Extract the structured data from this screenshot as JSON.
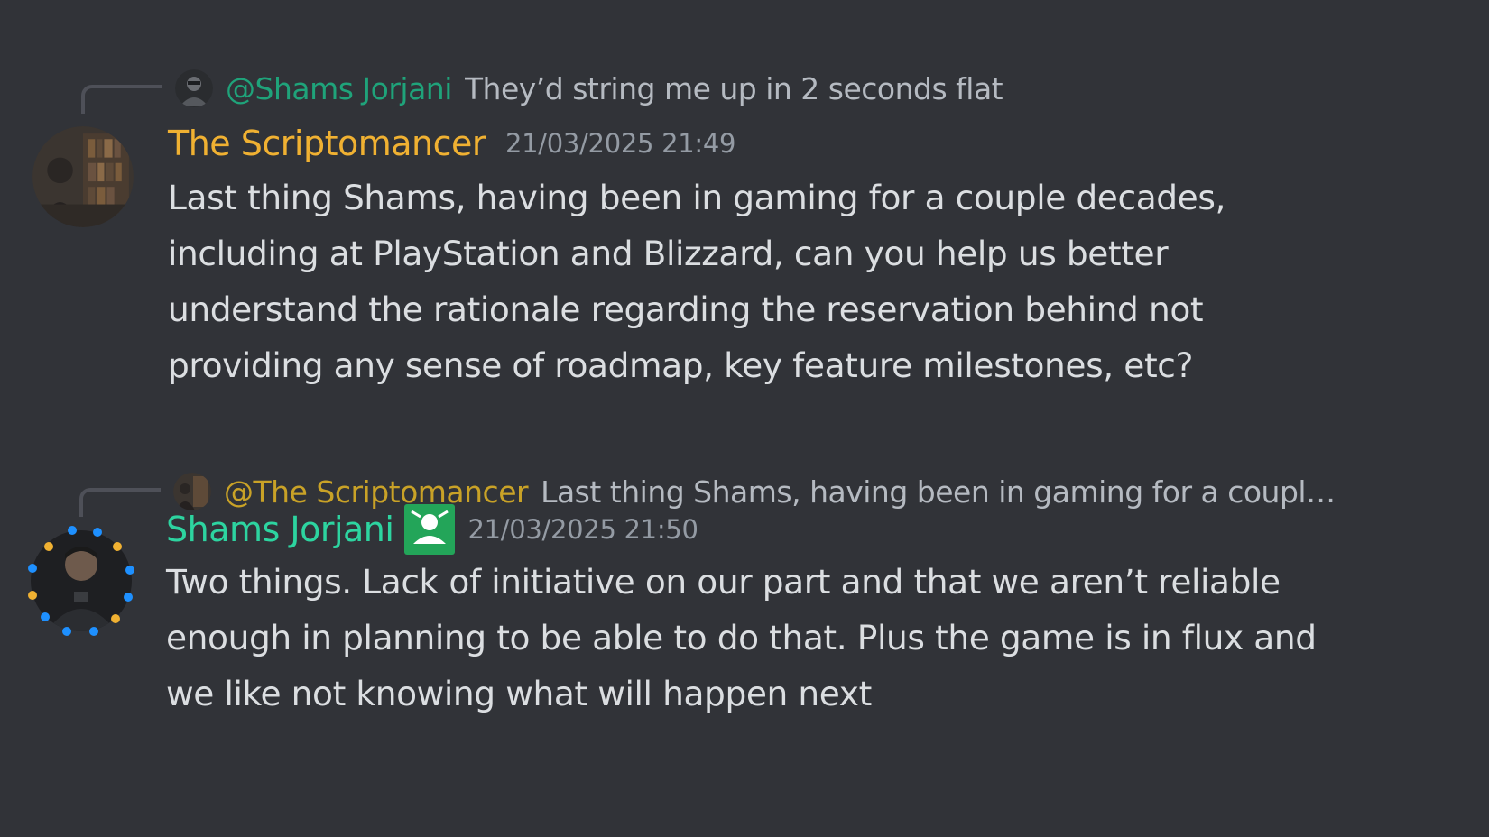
{
  "colors": {
    "background": "#313338",
    "text": "#dbdee1",
    "muted": "#b5bac1",
    "timestamp": "#949ba4",
    "scriptomancer": "#f0b132",
    "scriptomancer_reply": "#c9a227",
    "shams": "#2dd4a0",
    "shams_reply": "#1fa37a",
    "badge": "#23a559"
  },
  "messages": [
    {
      "reply": {
        "author": "@Shams Jorjani",
        "text": "They’d string me up in 2 seconds flat",
        "avatar_icon": "shams-jorjani-small-avatar"
      },
      "author": "The Scriptomancer",
      "timestamp": "21/03/2025 21:49",
      "avatar_icon": "scriptomancer-avatar",
      "lines": [
        "Last thing Shams, having been in gaming for a couple decades,",
        "including at PlayStation and Blizzard, can you help us better",
        "understand the rationale regarding the reservation behind not",
        "providing any sense of roadmap, key feature milestones, etc?"
      ]
    },
    {
      "reply": {
        "author": "@The Scriptomancer",
        "text": "Last thing Shams, having been in gaming for a coupl…",
        "avatar_icon": "scriptomancer-small-avatar"
      },
      "author": "Shams Jorjani",
      "badge_icon": "staff-badge-icon",
      "timestamp": "21/03/2025 21:50",
      "avatar_icon": "shams-jorjani-avatar",
      "lines": [
        "Two things. Lack of initiative on our part and that we aren’t reliable",
        "enough in planning to be able to do that. Plus the game is in flux and",
        "we like not knowing what will happen next"
      ]
    }
  ]
}
